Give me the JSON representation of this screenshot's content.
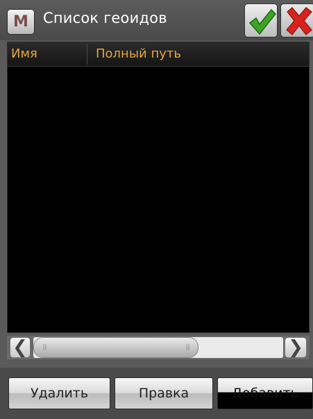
{
  "window": {
    "title": "Список геоидов",
    "app_icon_letter": "M"
  },
  "list": {
    "columns": [
      {
        "label": "Имя"
      },
      {
        "label": "Полный путь"
      }
    ],
    "rows": []
  },
  "scrollbar": {
    "left_arrow": "❮",
    "right_arrow": "❯",
    "position": 0.0,
    "visible_fraction": 0.66
  },
  "buttons": {
    "delete": "Удалить",
    "edit": "Правка",
    "add": "Добавить"
  },
  "icons": {
    "ok": "checkmark-icon",
    "close": "close-icon"
  },
  "colors": {
    "header_text": "#e3a63e",
    "ok_green": "#3da325",
    "close_red": "#d8231d"
  }
}
